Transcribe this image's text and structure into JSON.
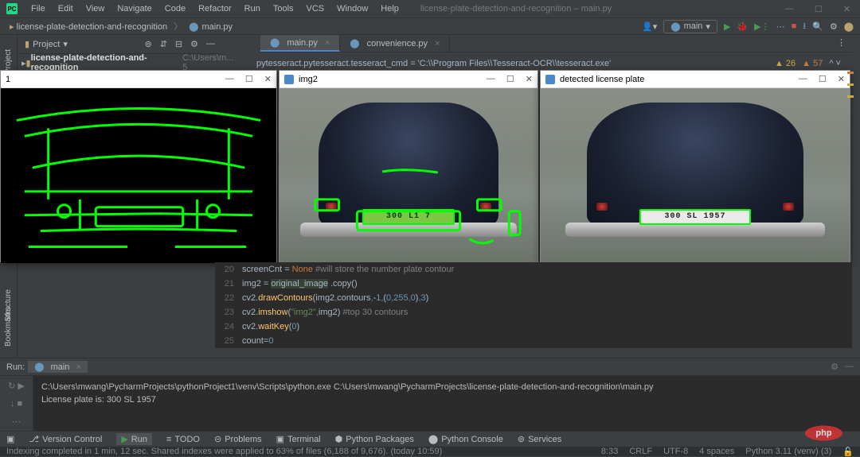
{
  "ide": {
    "logo": "PC",
    "title": "license-plate-detection-and-recognition – main.py"
  },
  "menu": [
    "File",
    "Edit",
    "View",
    "Navigate",
    "Code",
    "Refactor",
    "Run",
    "Tools",
    "VCS",
    "Window",
    "Help"
  ],
  "breadcrumb": {
    "project": "license-plate-detection-and-recognition",
    "file": "main.py"
  },
  "run_config": "main",
  "project_panel": {
    "label": "Project",
    "root": "license-plate-detection-and-recognition",
    "root_path": "C:\\Users\\m...   5"
  },
  "tabs": [
    {
      "name": "main.py",
      "active": true
    },
    {
      "name": "convenience.py",
      "active": false
    }
  ],
  "code_preview": "pytesseract.pytesseract.tesseract_cmd = 'C:\\\\Program Files\\\\Tesseract-OCR\\\\tesseract.exe'",
  "warnings": {
    "yellow": "26",
    "orange": "57"
  },
  "cv_windows": {
    "w1": {
      "title": "1"
    },
    "w2": {
      "title": "img2",
      "plate": "300 L1 7"
    },
    "w3": {
      "title": "detected license plate",
      "plate": "300 SL 1957"
    }
  },
  "ocr_popup": "300 SL 1957",
  "code_lines": [
    {
      "n": "20",
      "raw": "screenCnt = None #will store the number plate contour"
    },
    {
      "n": "21",
      "raw": "img2 = original_image .copy()"
    },
    {
      "n": "22",
      "raw": "cv2.drawContours(img2,contours,-1,(0,255,0),3)"
    },
    {
      "n": "23",
      "raw": "cv2.imshow(\"img2\",img2) #top 30 contours"
    },
    {
      "n": "24",
      "raw": "cv2.waitKey(0)"
    },
    {
      "n": "25",
      "raw": "count=0"
    }
  ],
  "run": {
    "label": "Run:",
    "config": "main",
    "out_line1": "C:\\Users\\mwang\\PycharmProjects\\pythonProject1\\venv\\Scripts\\python.exe C:\\Users\\mwang\\PycharmProjects\\license-plate-detection-and-recognition\\main.py",
    "out_line2": "License plate is: 300 SL 1957"
  },
  "tool_strip": [
    "Version Control",
    "Run",
    "TODO",
    "Problems",
    "Terminal",
    "Python Packages",
    "Python Console",
    "Services"
  ],
  "status": {
    "msg": "Indexing completed in 1 min, 12 sec. Shared indexes were applied to 63% of files (6,188 of 9,676). (today 10:59)",
    "pos": "8:33",
    "eol": "CRLF",
    "enc": "UTF-8",
    "indent": "4 spaces",
    "interp": "Python 3.11 (venv) (3)"
  },
  "gutters": {
    "project": "Project",
    "bookmarks": "Bookmarks",
    "structure": "Structure"
  },
  "badge": "php"
}
